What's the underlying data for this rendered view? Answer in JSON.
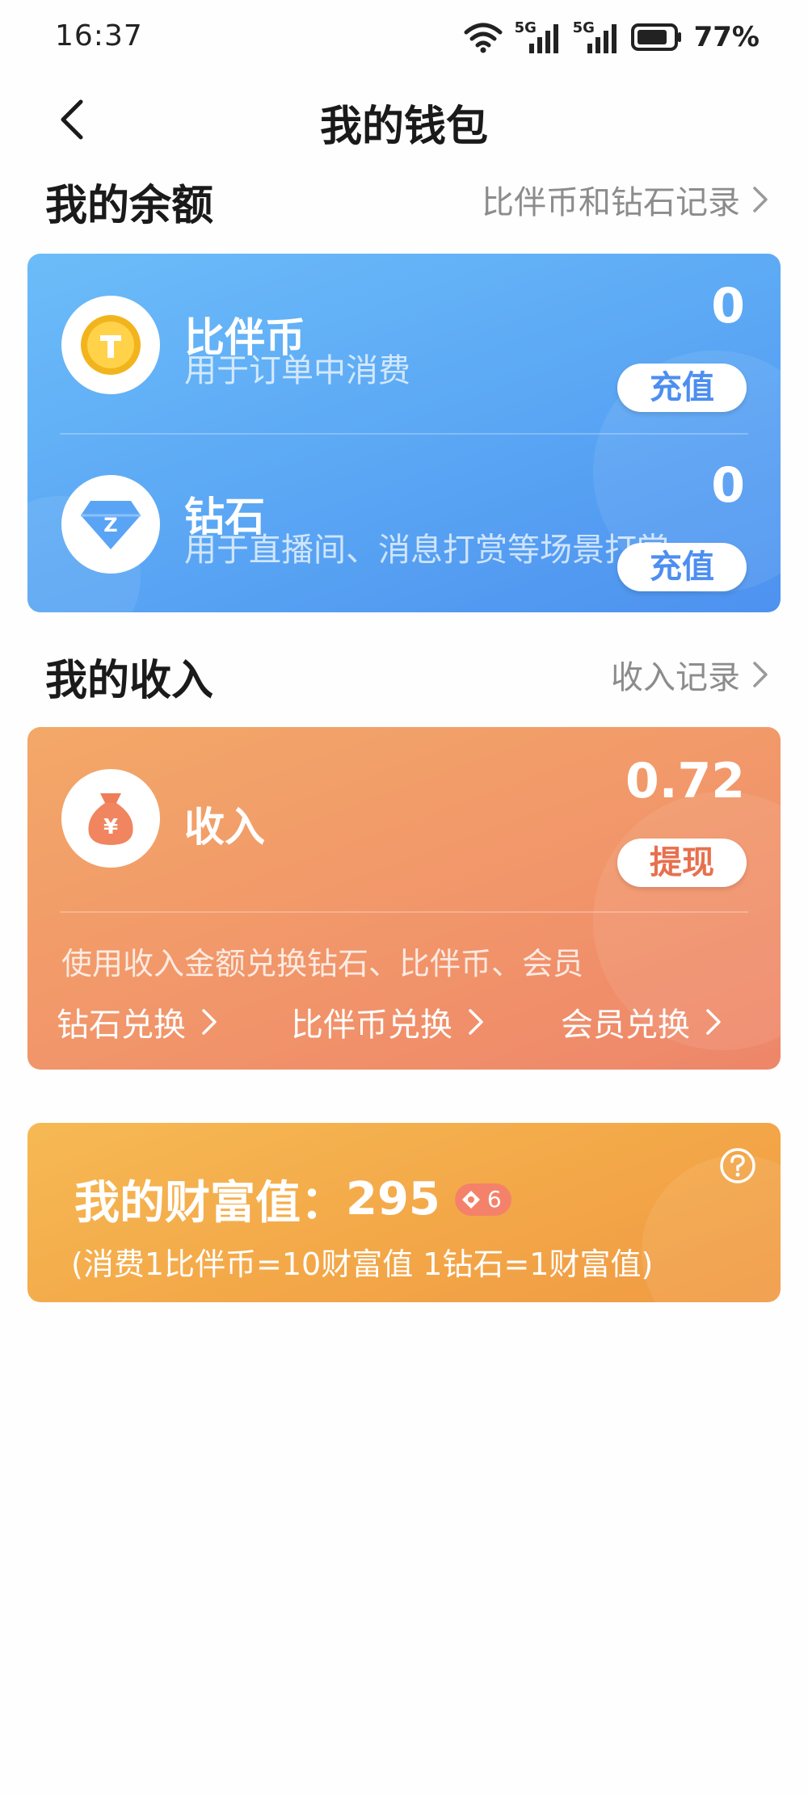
{
  "status_bar": {
    "time": "16:37",
    "battery": "77%",
    "signal_label_1": "5G",
    "signal_label_2": "5G"
  },
  "nav": {
    "title": "我的钱包"
  },
  "balance": {
    "section_title": "我的余额",
    "record_link": "比伴币和钻石记录",
    "items": [
      {
        "name": "比伴币",
        "desc": "用于订单中消费",
        "value": "0",
        "action": "充值",
        "icon": "gold-coin-icon"
      },
      {
        "name": "钻石",
        "desc": "用于直播间、消息打赏等场景打赏",
        "value": "0",
        "action": "充值",
        "icon": "diamond-icon"
      }
    ]
  },
  "income": {
    "section_title": "我的收入",
    "record_link": "收入记录",
    "name": "收入",
    "value": "0.72",
    "action": "提现",
    "hint": "使用收入金额兑换钻石、比伴币、会员",
    "exchanges": [
      "钻石兑换",
      "比伴币兑换",
      "会员兑换"
    ],
    "icon": "money-bag-icon"
  },
  "wealth": {
    "label": "我的财富值：",
    "value": "295",
    "level": "6",
    "note": "(消费1比伴币=10财富值 1钻石=1财富值)"
  },
  "colors": {
    "balance_accent": "#4d8ef0",
    "income_accent": "#e8704e",
    "wealth_card": "#f3a647"
  }
}
